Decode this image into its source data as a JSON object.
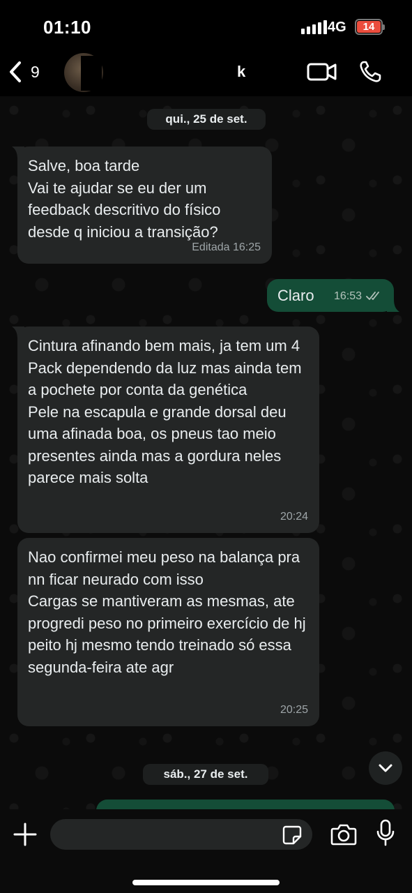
{
  "status_bar": {
    "time": "01:10",
    "network": "4G",
    "battery": "14"
  },
  "header": {
    "back_count": "9",
    "contact_name": "k"
  },
  "chat": {
    "date_1": "qui., 25 de set.",
    "date_2": "sáb., 27 de set.",
    "messages": [
      {
        "direction": "incoming",
        "text": "Salve, boa tarde\nVai te ajudar se eu der um feedback descritivo do físico desde q iniciou a transição?",
        "meta": "Editada 16:25"
      },
      {
        "direction": "outgoing",
        "text": "Claro",
        "meta": "16:53"
      },
      {
        "direction": "incoming",
        "text": "Cintura afinando bem mais, ja tem um 4 Pack dependendo da luz mas ainda tem a pochete por conta da genética\nPele na escapula e grande dorsal deu uma afinada boa, os pneus tao meio presentes ainda mas a gordura neles parece mais solta",
        "meta": "20:24"
      },
      {
        "direction": "incoming",
        "text": "Nao confirmei meu peso na balança pra nn ficar neurado com isso\nCargas se mantiveram as mesmas, ate progredi peso no primeiro exercício de hj peito hj mesmo tendo treinado só essa segunda-feira ate agr",
        "meta": "20:25"
      }
    ]
  },
  "composer": {
    "placeholder": ""
  },
  "colors": {
    "incoming_bubble": "#242626",
    "outgoing_bubble": "#144d37",
    "battery_low": "#eb4d3d"
  },
  "icons": {
    "back": "chevron-left-icon",
    "video": "video-camera-icon",
    "phone": "phone-icon",
    "scroll": "chevron-down-icon",
    "attach": "plus-icon",
    "sticker": "sticker-icon",
    "camera": "camera-icon",
    "mic": "microphone-icon",
    "read": "double-check-icon"
  }
}
